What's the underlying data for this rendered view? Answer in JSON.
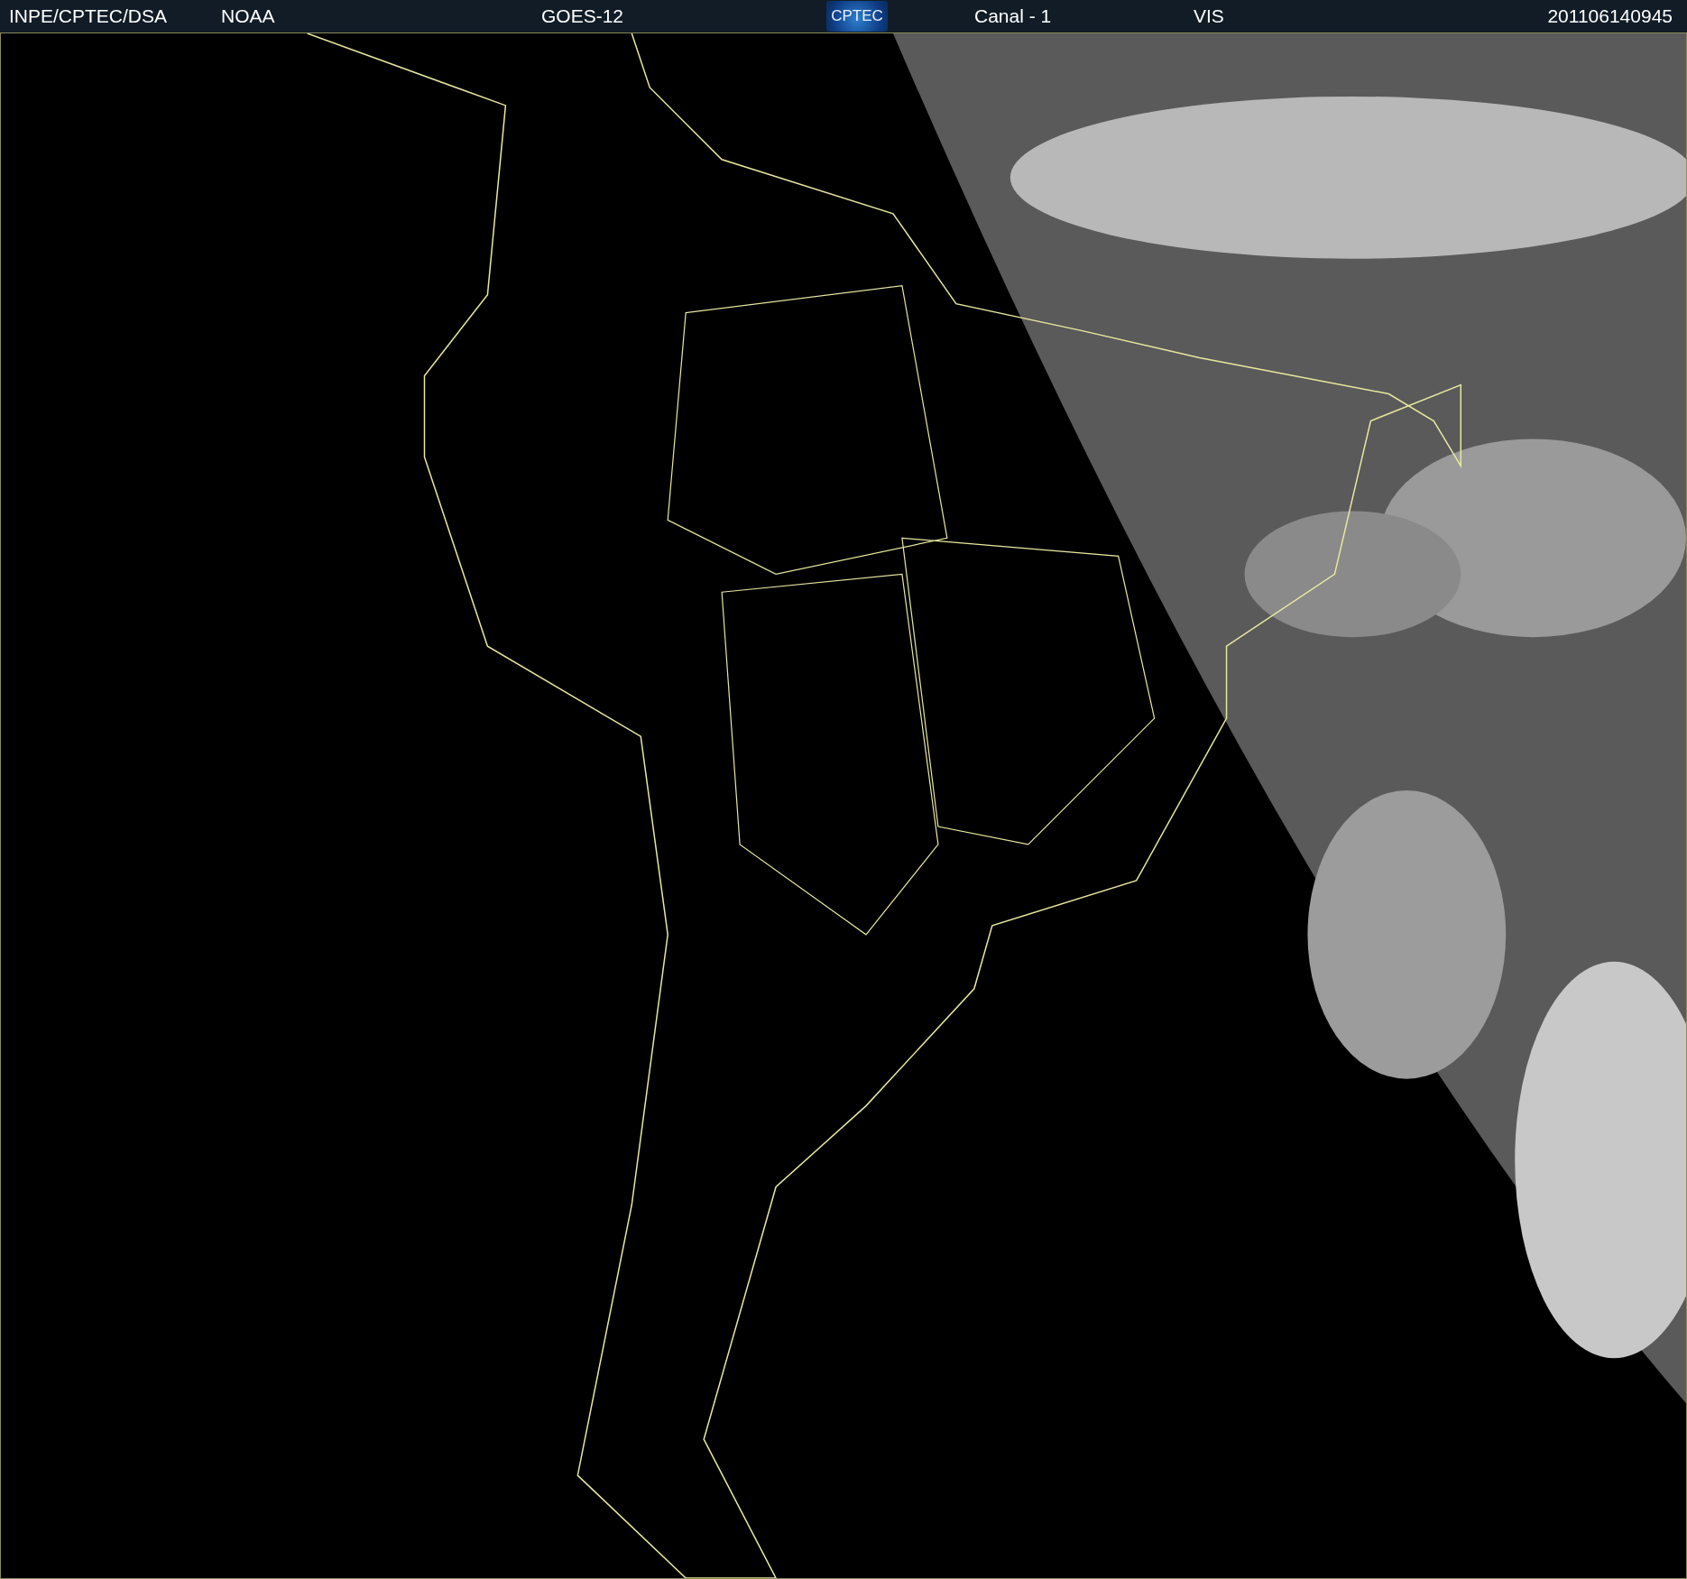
{
  "header": {
    "source": "INPE/CPTEC/DSA",
    "agency": "NOAA",
    "satellite": "GOES-12",
    "logo": "CPTEC",
    "channel": "Canal - 1",
    "band": "VIS",
    "timestamp": "201106140945"
  }
}
